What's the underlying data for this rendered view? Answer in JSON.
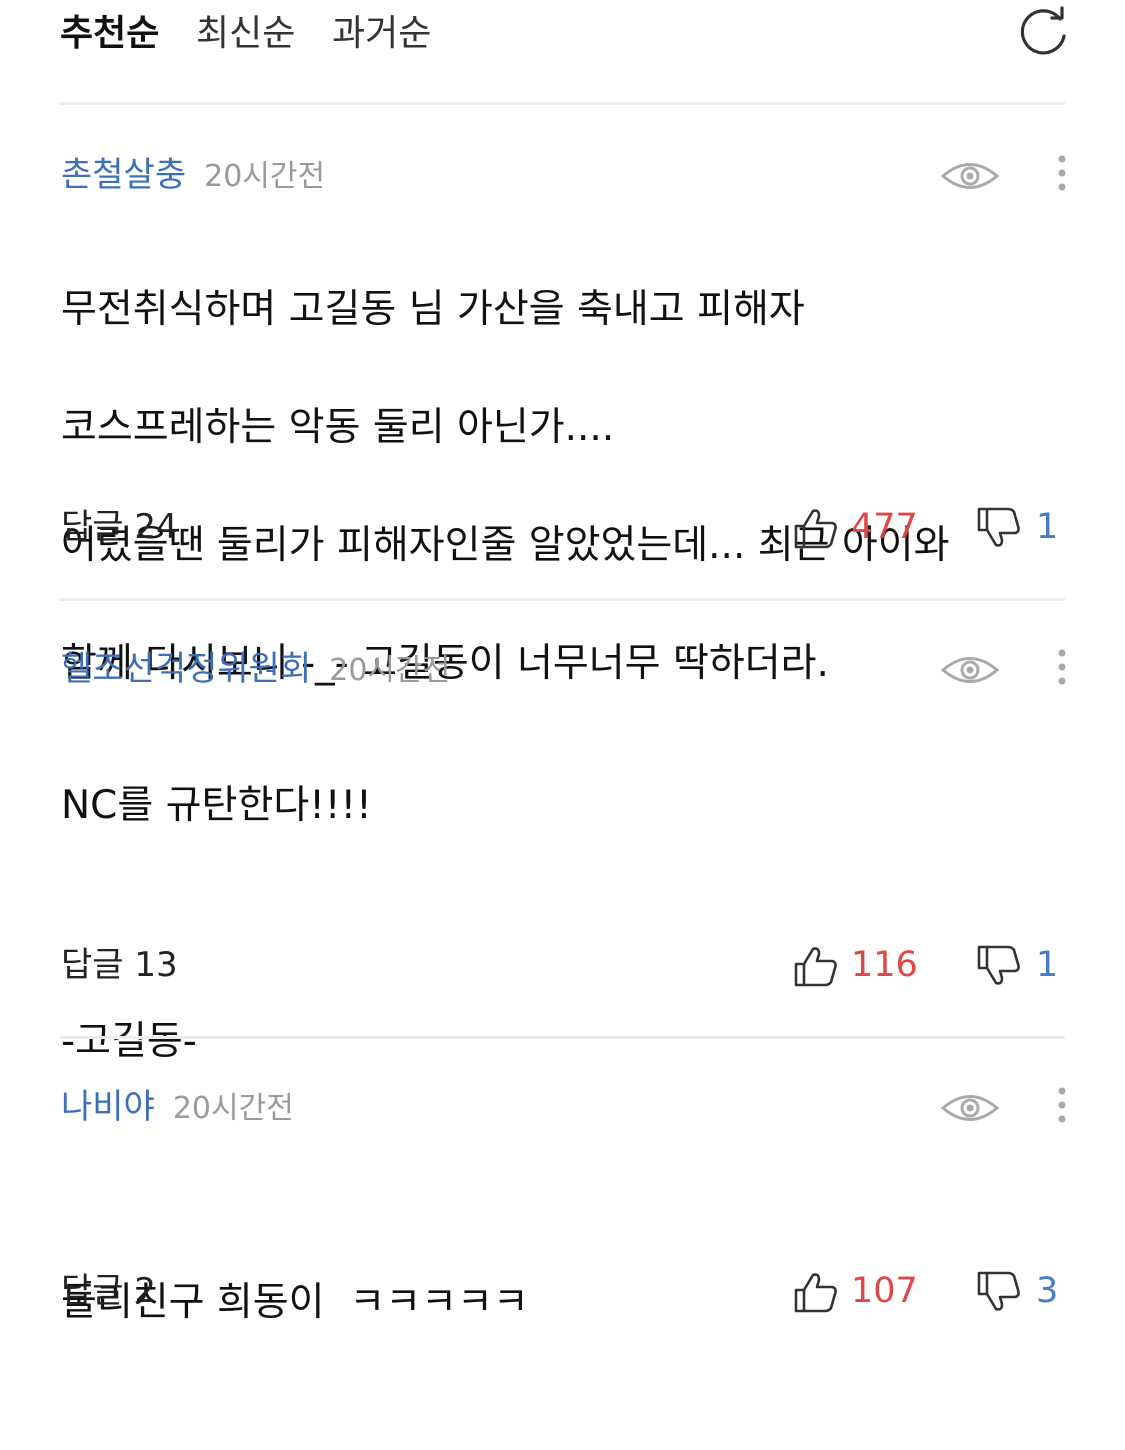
{
  "sort_tabs": [
    {
      "label": "추천순",
      "active": true
    },
    {
      "label": "최신순",
      "active": false
    },
    {
      "label": "과거순",
      "active": false
    }
  ],
  "icons": {
    "refresh": "refresh-icon",
    "view": "eye-icon",
    "more": "more-vertical-icon",
    "like": "thumbs-up-icon",
    "dislike": "thumbs-down-icon"
  },
  "colors": {
    "author": "#3d6fb6",
    "like": "#e04646",
    "dislike": "#4a7bc8"
  },
  "comments": [
    {
      "author": "촌철살충",
      "time": "20시간전",
      "lines": [
        "무전취식하며 고길동 님 가산을 축내고 피해자",
        "코스프레하는 악동 둘리 아닌가....",
        "어렸을땐 둘리가 피해자인줄 알았었는데... 최근 아이와",
        "함께 다시보니 -_- 고길동이 너무너무 딱하더라."
      ],
      "reply": "답글 24",
      "likes": "477",
      "dislikes": "1"
    },
    {
      "author": "헬조선걱정위원회",
      "time": "20시간전",
      "lines": [
        "NC를 규탄한다!!!!",
        "",
        "-고길동-"
      ],
      "reply": "답글 13",
      "likes": "116",
      "dislikes": "1"
    },
    {
      "author": "나비야",
      "time": "20시간전",
      "lines": [
        "둘리친구 희동이  ㅋㅋㅋㅋㅋ"
      ],
      "reply": "답글 2",
      "likes": "107",
      "dislikes": "3"
    }
  ]
}
